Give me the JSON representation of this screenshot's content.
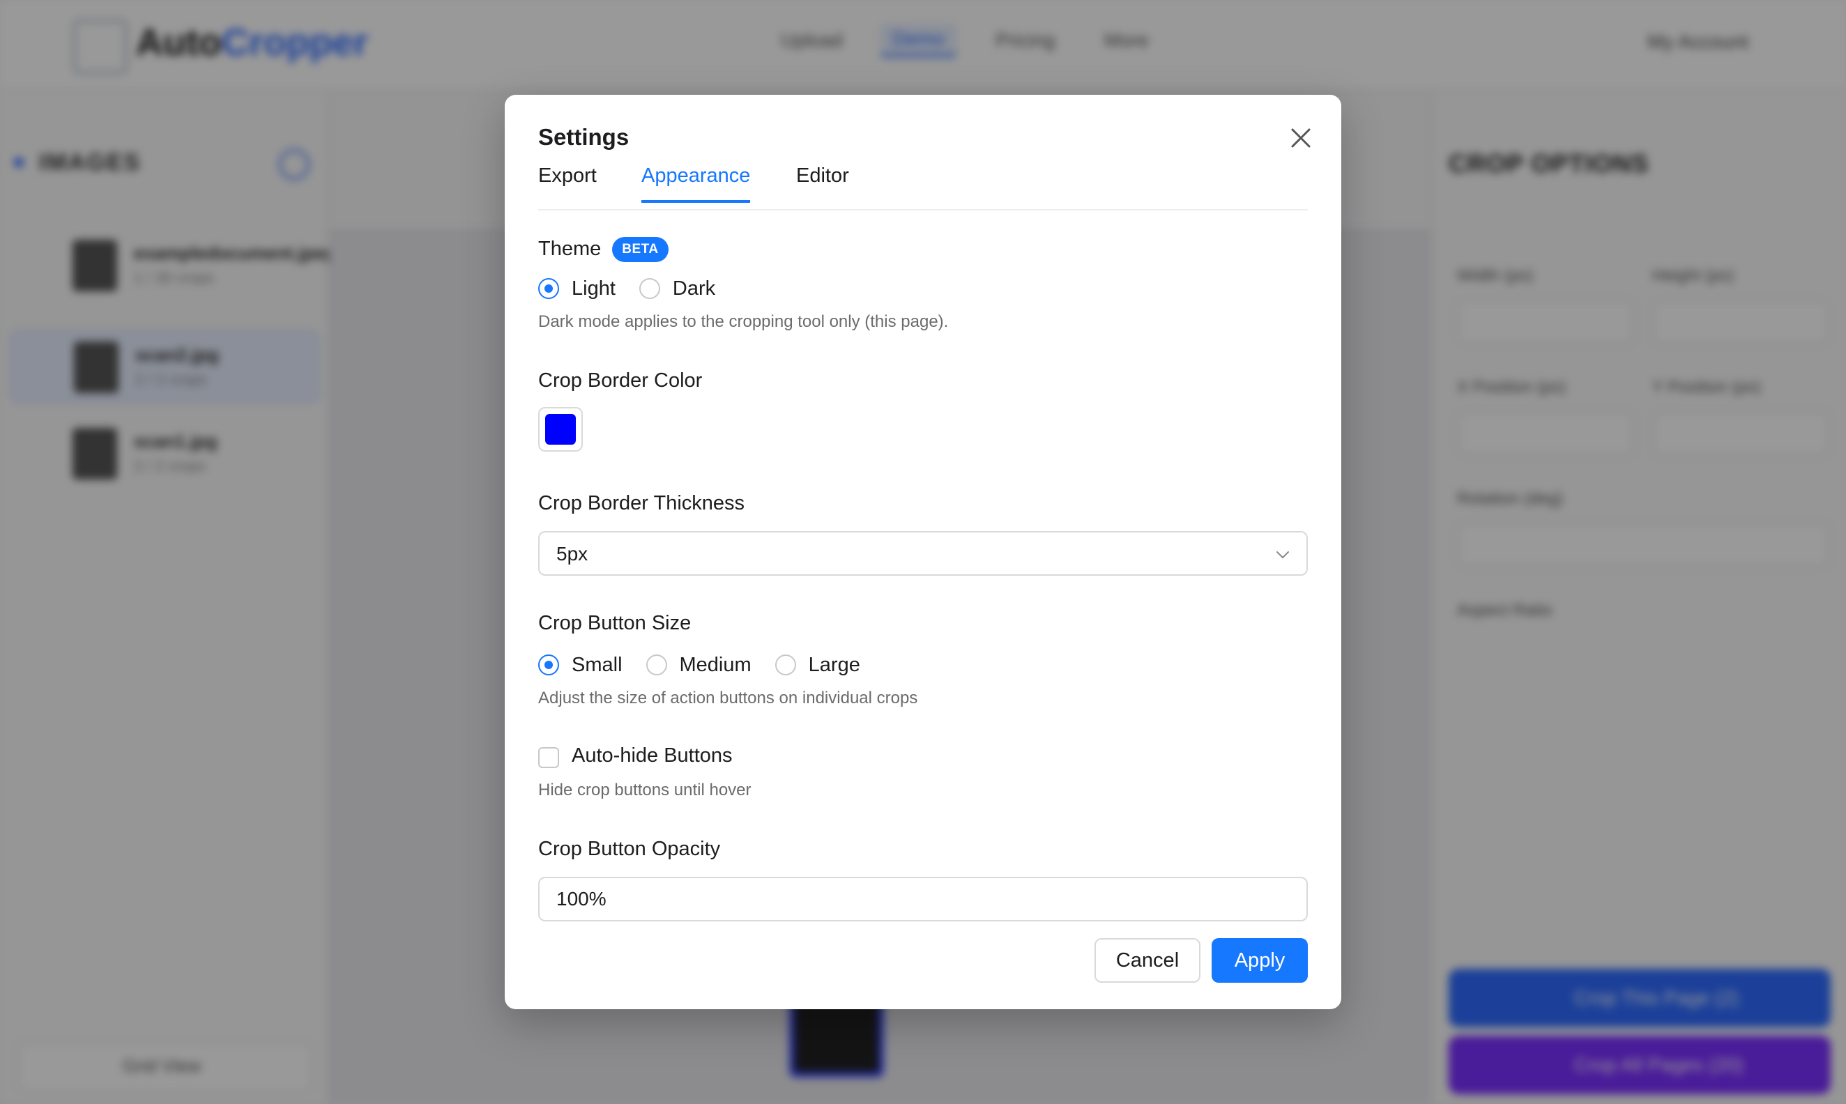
{
  "background": {
    "brand": {
      "name_part1": "Auto",
      "name_part2": "Cropper"
    },
    "nav": [
      "Upload",
      "Demo",
      "Pricing",
      "More"
    ],
    "account": "My Account",
    "left_panel": {
      "title": "IMAGES",
      "files": [
        {
          "name": "exampledocument.jpeg",
          "sub": "1 / 30 crops"
        },
        {
          "name": "scan2.jpg",
          "sub": "2 / 2 crops"
        },
        {
          "name": "scan1.jpg",
          "sub": "2 / 2 crops"
        }
      ],
      "bottom_button": "Grid View"
    },
    "right_panel": {
      "title": "CROP OPTIONS",
      "fields": [
        "Width (px)",
        "Height (px)",
        "X Position (px)",
        "Y Position (px)",
        "Rotation (deg)",
        "Aspect Ratio"
      ],
      "crop_page_button": "Crop This Page (2)",
      "crop_all_button": "Crop All Pages (20)"
    }
  },
  "modal": {
    "title": "Settings",
    "tabs": [
      {
        "label": "Export",
        "active": false
      },
      {
        "label": "Appearance",
        "active": true
      },
      {
        "label": "Editor",
        "active": false
      }
    ],
    "theme": {
      "label": "Theme",
      "badge": "BETA",
      "options": [
        "Light",
        "Dark"
      ],
      "selected": "Light",
      "help": "Dark mode applies to the cropping tool only (this page)."
    },
    "border_color": {
      "label": "Crop Border Color",
      "value": "#0000ff"
    },
    "border_thickness": {
      "label": "Crop Border Thickness",
      "value": "5px"
    },
    "button_size": {
      "label": "Crop Button Size",
      "options": [
        "Small",
        "Medium",
        "Large"
      ],
      "selected": "Small",
      "help": "Adjust the size of action buttons on individual crops"
    },
    "auto_hide": {
      "label": "Auto-hide Buttons",
      "checked": false,
      "help": "Hide crop buttons until hover"
    },
    "opacity": {
      "label": "Crop Button Opacity",
      "value": "100%"
    },
    "buttons": {
      "cancel": "Cancel",
      "apply": "Apply"
    }
  },
  "colors": {
    "accent": "#1677ff",
    "border_color_swatch": "#0000ff"
  }
}
